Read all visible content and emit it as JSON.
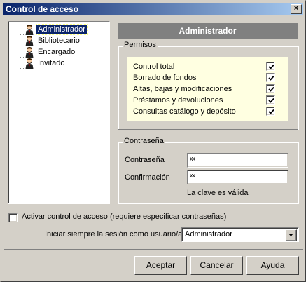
{
  "window": {
    "title": "Control de acceso",
    "close_glyph": "×"
  },
  "tree": {
    "items": [
      {
        "label": "Administrador",
        "selected": true
      },
      {
        "label": "Bibliotecario",
        "selected": false
      },
      {
        "label": "Encargado",
        "selected": false
      },
      {
        "label": "Invitado",
        "selected": false
      }
    ],
    "icon": "user-icon"
  },
  "panel": {
    "header": "Administrador"
  },
  "permisos": {
    "title": "Permisos",
    "items": [
      {
        "label": "Control total",
        "checked": true
      },
      {
        "label": "Borrado de fondos",
        "checked": true
      },
      {
        "label": "Altas, bajas y modificaciones",
        "checked": true
      },
      {
        "label": "Préstamos y devoluciones",
        "checked": true
      },
      {
        "label": "Consultas catálogo y depósito",
        "checked": true
      }
    ]
  },
  "password": {
    "title": "Contraseña",
    "password_label": "Contraseña",
    "password_value": "xx",
    "confirm_label": "Confirmación",
    "confirm_value": "xx",
    "status": "La clave es válida"
  },
  "options": {
    "activate_label": "Activar control de acceso (requiere especificar contraseñas)",
    "activate_checked": false,
    "session_label": "Iniciar siempre la sesión como usuario/a",
    "session_value": "Administrador"
  },
  "buttons": {
    "accept": "Aceptar",
    "cancel": "Cancelar",
    "help": "Ayuda"
  },
  "colors": {
    "titlebar_start": "#0a246a",
    "titlebar_end": "#a6caf0",
    "permissions_bg": "#ffffe1",
    "header_bg": "#808080"
  }
}
